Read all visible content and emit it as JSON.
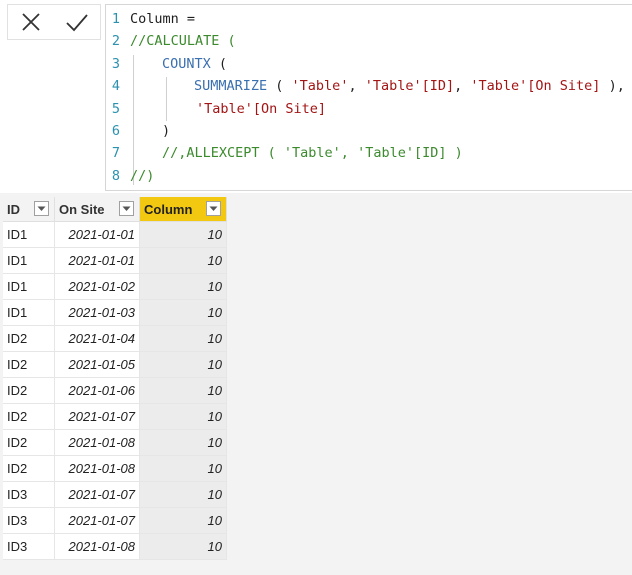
{
  "formula_bar": {
    "cancel_icon": "x-icon",
    "commit_icon": "check-icon",
    "lines": [
      {
        "num": "1",
        "segments": [
          {
            "text": "Column =",
            "color": "black"
          }
        ]
      },
      {
        "num": "2",
        "segments": [
          {
            "text": "//CALCULATE (",
            "color": "green"
          }
        ]
      },
      {
        "num": "3",
        "segments": [
          {
            "text": "COUNTX",
            "color": "blue"
          },
          {
            "text": " (",
            "color": "black"
          }
        ]
      },
      {
        "num": "4",
        "segments": [
          {
            "text": "SUMMARIZE",
            "color": "blue"
          },
          {
            "text": " ( ",
            "color": "black"
          },
          {
            "text": "'Table'",
            "color": "red"
          },
          {
            "text": ", ",
            "color": "black"
          },
          {
            "text": "'Table'[ID]",
            "color": "red"
          },
          {
            "text": ", ",
            "color": "black"
          },
          {
            "text": "'Table'[On Site]",
            "color": "red"
          },
          {
            "text": " ),",
            "color": "black"
          }
        ]
      },
      {
        "num": "5",
        "segments": [
          {
            "text": "'Table'[On Site]",
            "color": "red"
          }
        ]
      },
      {
        "num": "6",
        "segments": [
          {
            "text": ")",
            "color": "black"
          }
        ]
      },
      {
        "num": "7",
        "segments": [
          {
            "text": "//,ALLEXCEPT ( 'Table', 'Table'[ID] )",
            "color": "green"
          }
        ]
      },
      {
        "num": "8",
        "segments": [
          {
            "text": "//)",
            "color": "green"
          }
        ]
      }
    ]
  },
  "table": {
    "headers": {
      "id": "ID",
      "on_site": "On Site",
      "column": "Column"
    },
    "filter_icon": "chevron-down-icon",
    "rows": [
      {
        "id": "ID1",
        "on_site": "2021-01-01",
        "column": "10"
      },
      {
        "id": "ID1",
        "on_site": "2021-01-01",
        "column": "10"
      },
      {
        "id": "ID1",
        "on_site": "2021-01-02",
        "column": "10"
      },
      {
        "id": "ID1",
        "on_site": "2021-01-03",
        "column": "10"
      },
      {
        "id": "ID2",
        "on_site": "2021-01-04",
        "column": "10"
      },
      {
        "id": "ID2",
        "on_site": "2021-01-05",
        "column": "10"
      },
      {
        "id": "ID2",
        "on_site": "2021-01-06",
        "column": "10"
      },
      {
        "id": "ID2",
        "on_site": "2021-01-07",
        "column": "10"
      },
      {
        "id": "ID2",
        "on_site": "2021-01-08",
        "column": "10"
      },
      {
        "id": "ID2",
        "on_site": "2021-01-08",
        "column": "10"
      },
      {
        "id": "ID3",
        "on_site": "2021-01-07",
        "column": "10"
      },
      {
        "id": "ID3",
        "on_site": "2021-01-07",
        "column": "10"
      },
      {
        "id": "ID3",
        "on_site": "2021-01-08",
        "column": "10"
      }
    ]
  },
  "colors": {
    "selected_header": "#f2c811",
    "code_green": "#3c8a2e",
    "code_blue": "#3a6fb0",
    "code_red": "#a31515",
    "line_number": "#2b91af"
  }
}
